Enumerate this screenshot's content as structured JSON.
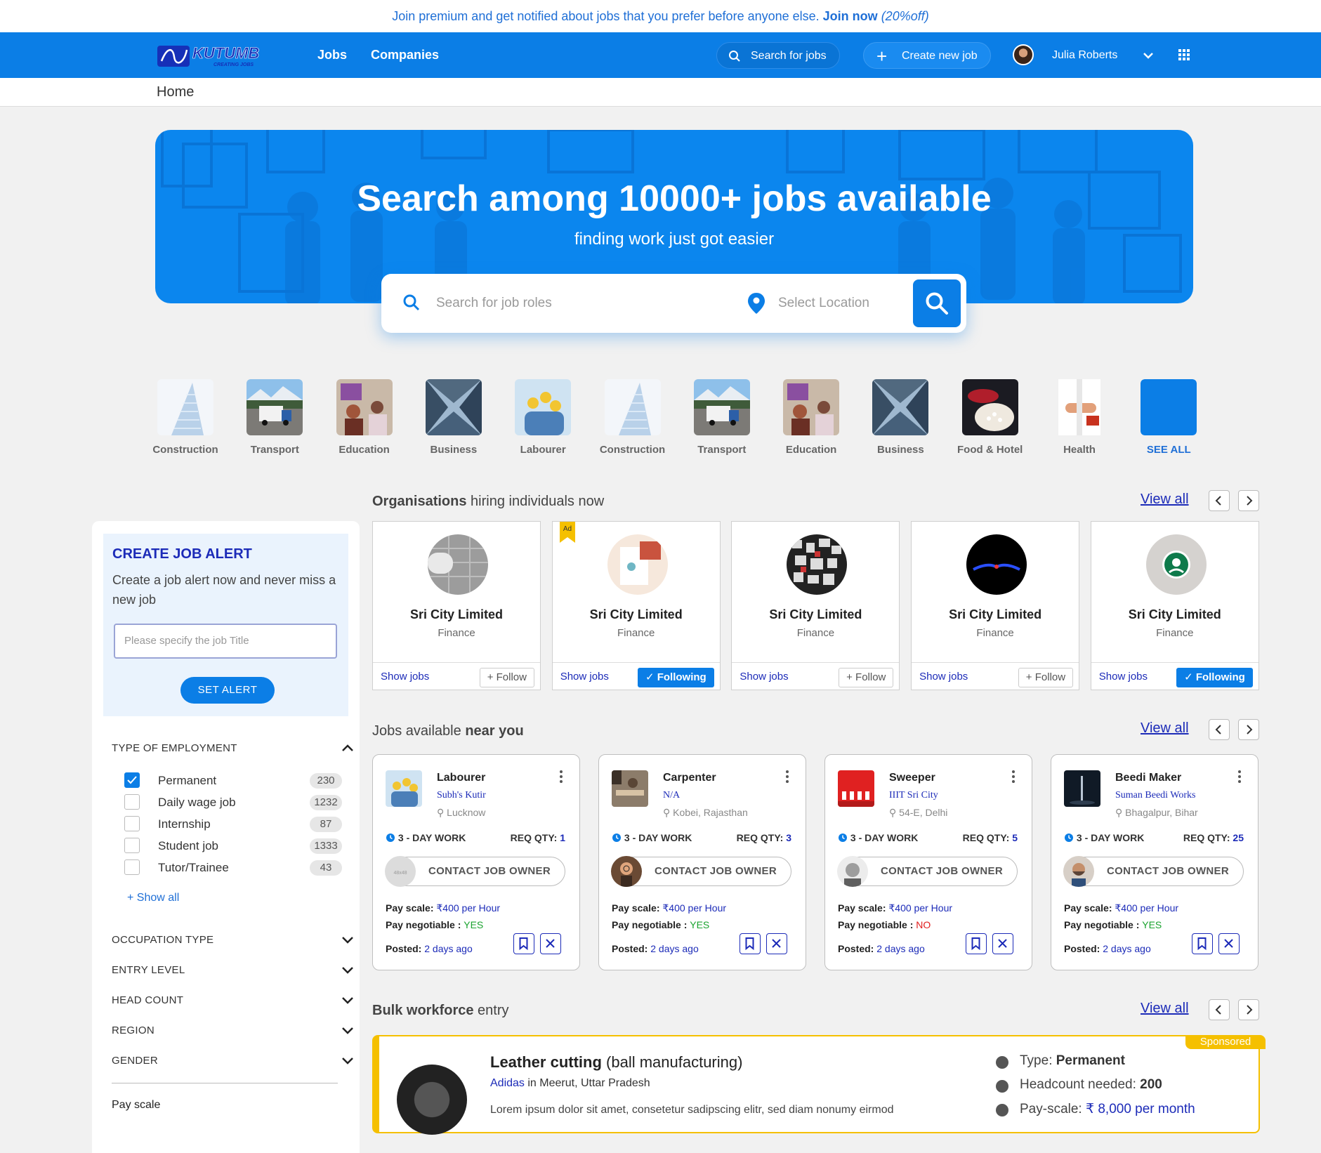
{
  "premium_bar": {
    "text": "Join premium and get notified about jobs that you prefer before anyone else.",
    "link": "Join now",
    "offer": "(20%off)"
  },
  "nav": {
    "logo_alt": "CREATING JOBS",
    "links": [
      "Jobs",
      "Companies"
    ],
    "search_label": "Search for jobs",
    "create_label": "Create new job",
    "user_name": "Julia Roberts"
  },
  "breadcrumb": "Home",
  "hero": {
    "title": "Search among 10000+ jobs available",
    "subtitle": "finding work just got easier",
    "role_placeholder": "Search for job roles",
    "location_placeholder": "Select Location"
  },
  "categories": [
    {
      "label": "Construction",
      "icon": "building-photo"
    },
    {
      "label": "Transport",
      "icon": "truck-photo"
    },
    {
      "label": "Education",
      "icon": "classroom-photo"
    },
    {
      "label": "Business",
      "icon": "skyscraper-photo"
    },
    {
      "label": "Labourer",
      "icon": "workers-photo"
    },
    {
      "label": "Construction",
      "icon": "building-photo"
    },
    {
      "label": "Transport",
      "icon": "truck-photo"
    },
    {
      "label": "Education",
      "icon": "classroom-photo"
    },
    {
      "label": "Business",
      "icon": "skyscraper-photo"
    },
    {
      "label": "Food & Hotel",
      "icon": "food-photo"
    },
    {
      "label": "Health",
      "icon": "doctor-photo"
    },
    {
      "label": "SEE ALL",
      "icon": "see-all-tile"
    }
  ],
  "job_alert": {
    "title": "CREATE JOB ALERT",
    "description": "Create a job alert now and never miss a new job",
    "input_placeholder": "Please specify the job Title",
    "button": "SET ALERT"
  },
  "filters": {
    "employment_title": "TYPE OF EMPLOYMENT",
    "employment": [
      {
        "label": "Permanent",
        "count": "230",
        "checked": true
      },
      {
        "label": "Daily wage job",
        "count": "1232",
        "checked": false
      },
      {
        "label": "Internship",
        "count": "87",
        "checked": false
      },
      {
        "label": "Student job",
        "count": "1333",
        "checked": false
      },
      {
        "label": "Tutor/Trainee",
        "count": "43",
        "checked": false
      }
    ],
    "show_all": "Show all",
    "collapsed": [
      "OCCUPATION TYPE",
      "ENTRY LEVEL",
      "HEAD COUNT",
      "REGION",
      "GENDER"
    ],
    "pay_scale": "Pay scale"
  },
  "orgs_section": {
    "title_bold": "Organisations",
    "title_rest": " hiring individuals now",
    "view_all": "View all"
  },
  "orgs": [
    {
      "name": "Sri City Limited",
      "sector": "Finance",
      "show": "Show jobs",
      "follow": "Follow",
      "following": false,
      "ad": false
    },
    {
      "name": "Sri City Limited",
      "sector": "Finance",
      "show": "Show jobs",
      "follow": "Following",
      "following": true,
      "ad": true,
      "ad_label": "Ad"
    },
    {
      "name": "Sri City Limited",
      "sector": "Finance",
      "show": "Show jobs",
      "follow": "Follow",
      "following": false,
      "ad": false
    },
    {
      "name": "Sri City Limited",
      "sector": "Finance",
      "show": "Show jobs",
      "follow": "Follow",
      "following": false,
      "ad": false
    },
    {
      "name": "Sri City Limited",
      "sector": "Finance",
      "show": "Show jobs",
      "follow": "Following",
      "following": true,
      "ad": false
    }
  ],
  "jobs_section": {
    "title_rest": "Jobs available ",
    "title_bold": "near you",
    "view_all": "View all"
  },
  "jobs": [
    {
      "title": "Labourer",
      "company": "Subh's Kutir",
      "location": "Lucknow",
      "duration": "3 - DAY WORK",
      "qty_label": "REQ QTY: ",
      "qty": "1",
      "contact": "CONTACT JOB OWNER",
      "pay_label": "Pay scale: ",
      "pay": "₹400 per Hour",
      "neg_label": "Pay negotiable : ",
      "negotiable": "YES",
      "posted_label": "Posted: ",
      "posted": "2 days ago"
    },
    {
      "title": "Carpenter",
      "company": "N/A",
      "location": "Kobei, Rajasthan",
      "duration": "3 - DAY WORK",
      "qty_label": "REQ QTY: ",
      "qty": "3",
      "contact": "CONTACT JOB OWNER",
      "pay_label": "Pay scale: ",
      "pay": "₹400 per Hour",
      "neg_label": "Pay negotiable : ",
      "negotiable": "YES",
      "posted_label": "Posted: ",
      "posted": "2 days ago"
    },
    {
      "title": "Sweeper",
      "company": "IIIT Sri City",
      "location": "54-E, Delhi",
      "duration": "3 - DAY WORK",
      "qty_label": "REQ QTY: ",
      "qty": "5",
      "contact": "CONTACT JOB OWNER",
      "pay_label": "Pay scale: ",
      "pay": "₹400 per Hour",
      "neg_label": "Pay negotiable : ",
      "negotiable": "NO",
      "posted_label": "Posted: ",
      "posted": "2 days ago"
    },
    {
      "title": "Beedi Maker",
      "company": "Suman Beedi Works",
      "location": "Bhagalpur, Bihar",
      "duration": "3 - DAY WORK",
      "qty_label": "REQ QTY: ",
      "qty": "25",
      "contact": "CONTACT JOB OWNER",
      "pay_label": "Pay scale: ",
      "pay": "₹400 per Hour",
      "neg_label": "Pay negotiable : ",
      "negotiable": "YES",
      "posted_label": "Posted: ",
      "posted": "2 days ago"
    }
  ],
  "bulk_section": {
    "title_bold": "Bulk workforce",
    "title_rest": " entry",
    "view_all": "View all"
  },
  "bulk": {
    "tag": "Sponsored",
    "title_bold": "Leather cutting",
    "title_rest": " (ball manufacturing)",
    "company": "Adidas",
    "company_in": " in Meerut, Uttar Pradesh",
    "description": "Lorem ipsum dolor sit amet, consetetur sadipscing elitr, sed diam nonumy eirmod",
    "type_label": "Type: ",
    "type": "Permanent",
    "headcount_label": "Headcount needed: ",
    "headcount": "200",
    "pay_label": "Pay-scale: ",
    "pay": "₹ 8,000 per month"
  },
  "colors": {
    "primary": "#0b7ee6",
    "link": "#1c2bb8",
    "yes": "#1aa32f",
    "no": "#e11d1d",
    "sponsored": "#f5c000"
  }
}
